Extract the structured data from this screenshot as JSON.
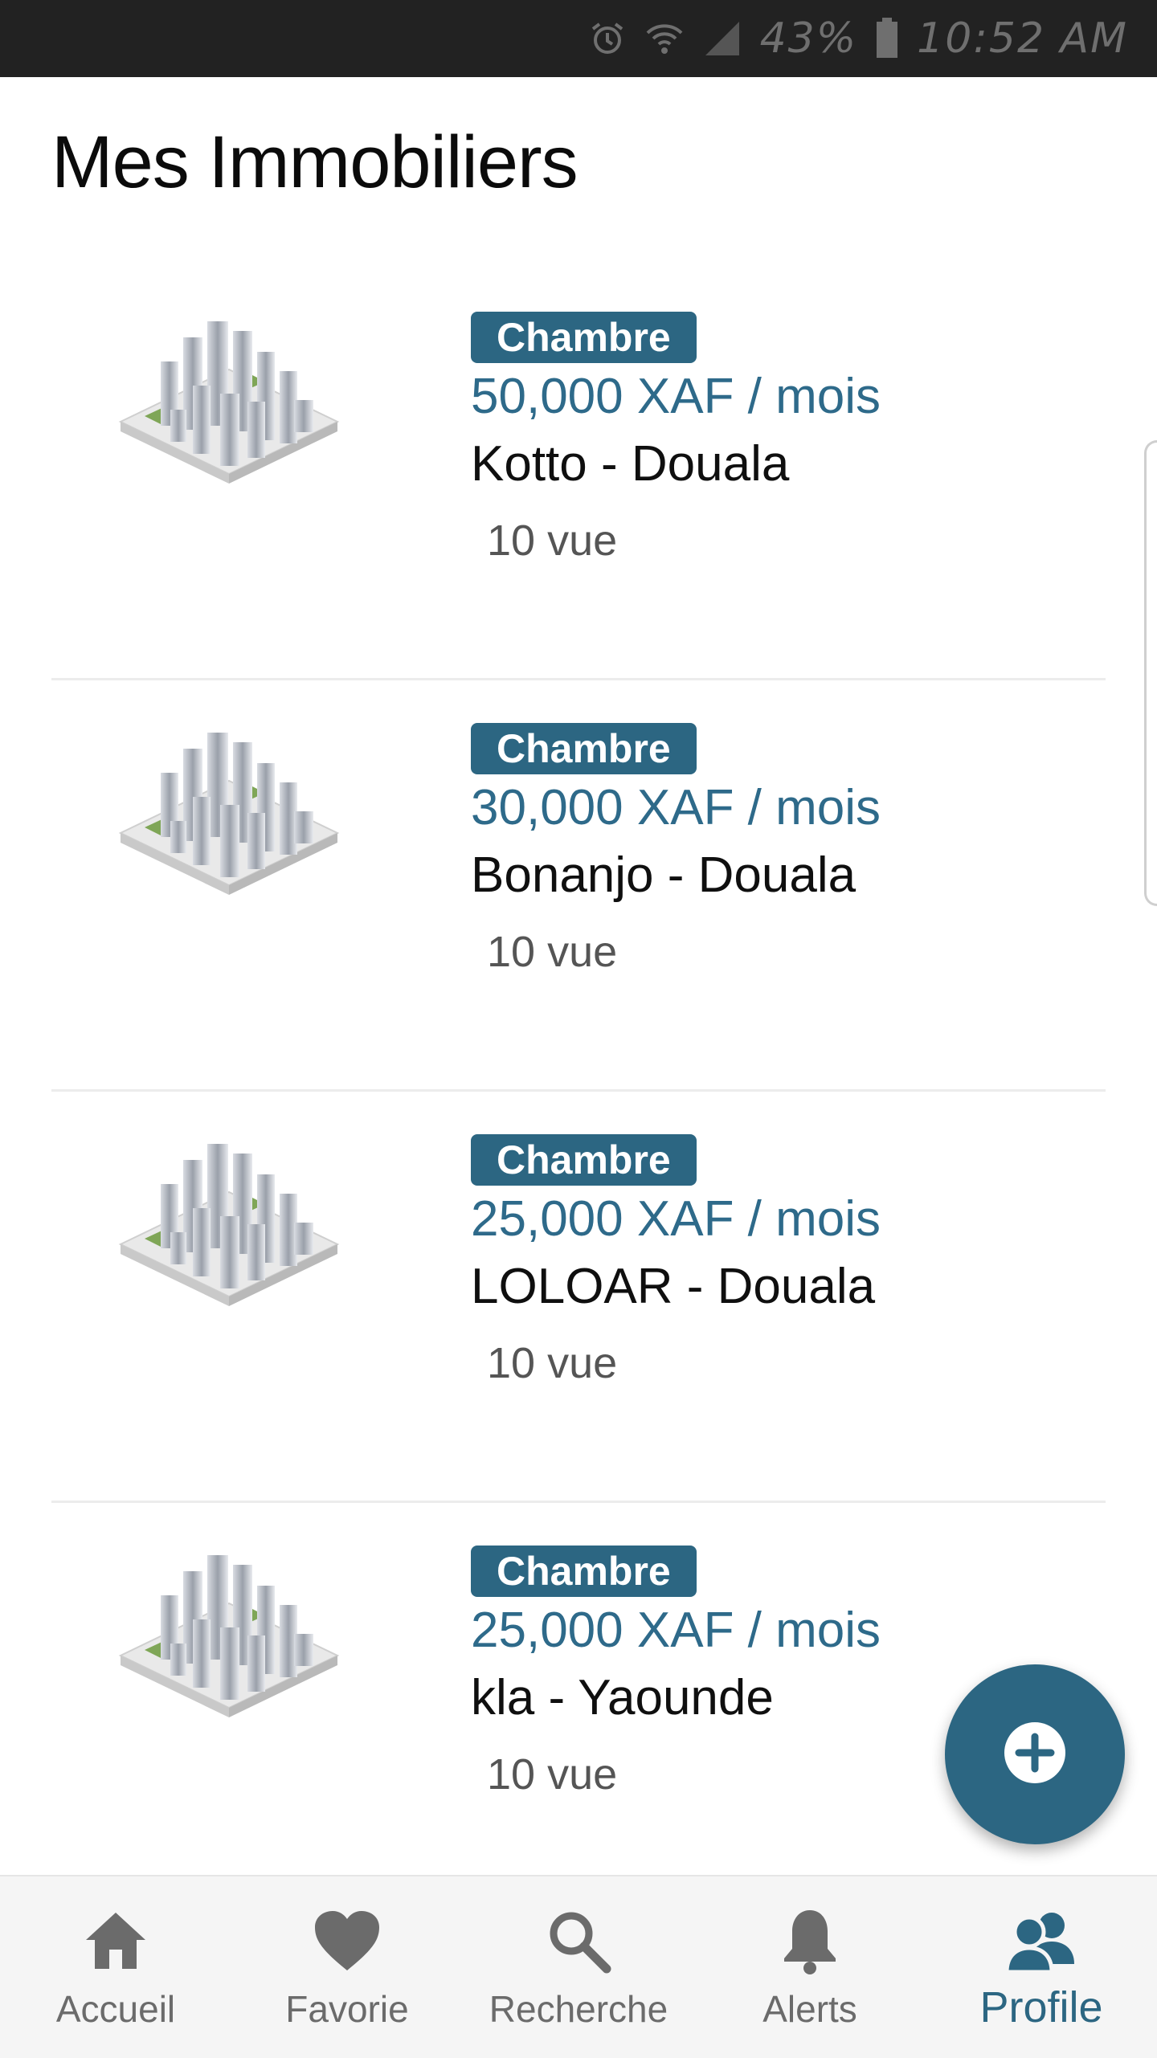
{
  "status_bar": {
    "battery": "43%",
    "time": "10:52 AM",
    "icons": [
      "alarm-icon",
      "wifi-icon",
      "signal-icon",
      "battery-icon"
    ]
  },
  "page": {
    "title": "Mes Immobiliers"
  },
  "listings": [
    {
      "type": "Chambre",
      "price": "50,000 XAF / mois",
      "location": "Kotto - Douala",
      "views": "10 vue"
    },
    {
      "type": "Chambre",
      "price": "30,000 XAF / mois",
      "location": "Bonanjo - Douala",
      "views": "10 vue"
    },
    {
      "type": "Chambre",
      "price": "25,000 XAF / mois",
      "location": "LOLOAR - Douala",
      "views": "10 vue"
    },
    {
      "type": "Chambre",
      "price": "25,000 XAF / mois",
      "location": "kla - Yaounde",
      "views": "10 vue"
    }
  ],
  "fab": {
    "icon": "plus-circle-icon"
  },
  "nav": {
    "items": [
      {
        "label": "Accueil",
        "icon": "home-icon"
      },
      {
        "label": "Favorie",
        "icon": "heart-icon"
      },
      {
        "label": "Recherche",
        "icon": "search-icon"
      },
      {
        "label": "Alerts",
        "icon": "bell-icon"
      },
      {
        "label": "Profile",
        "icon": "users-icon"
      }
    ],
    "active": "Profile"
  },
  "colors": {
    "accent": "#2c6682",
    "price": "#2e6a8a",
    "status_bar_bg": "#222222",
    "nav_bg": "#f5f5f5",
    "nav_inactive": "#6b6b6b"
  }
}
